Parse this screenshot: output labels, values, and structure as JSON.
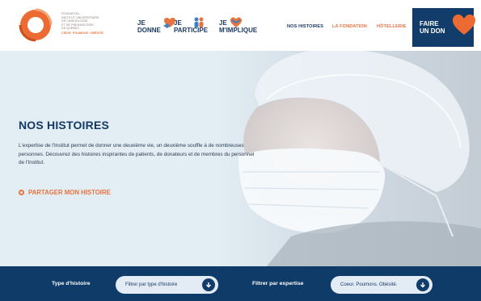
{
  "header": {
    "logo": {
      "lines": [
        "FONDATION",
        "INSTITUT UNIVERSITAIRE",
        "DE CARDIOLOGIE",
        "ET DE PNEUMOLOGIE",
        "DE QUÉBEC"
      ],
      "tagline": "CŒUR. POUMONS. OBÉSITÉ."
    },
    "engage": [
      {
        "line1": "JE",
        "line2": "DONNE",
        "icon": "heart-hands-icon"
      },
      {
        "line1": "JE",
        "line2": "PARTICIPE",
        "icon": "people-icon"
      },
      {
        "line1": "JE",
        "line2": "M'IMPLIQUE",
        "icon": "heart-ribbon-icon"
      }
    ],
    "nav": [
      "NOS HISTOIRES",
      "LA FONDATION",
      "HÔTELLERIE"
    ],
    "donate": {
      "line1": "FAIRE",
      "line2": "UN DON",
      "icon": "heart-icon"
    }
  },
  "hero": {
    "title": "NOS HISTOIRES",
    "text": "L'expertise de l'Institut permet de donner une deuxième vie, un deuxième souffle à de nombreuses personnes. Découvrez des histoires inspirantes de patients, de donateurs et de membres du personnel de l'Institut.",
    "link": "PARTAGER MON HISTOIRE"
  },
  "filters": {
    "type_label": "Type d'histoire",
    "type_value": "Filtrer par type d'histoire",
    "expertise_label": "Filtrer par expertise",
    "expertise_value": "Coeur. Poumons. Obésité."
  },
  "colors": {
    "navy": "#123d6a",
    "orange": "#e7733f",
    "hero_bg": "#e3edf4"
  }
}
